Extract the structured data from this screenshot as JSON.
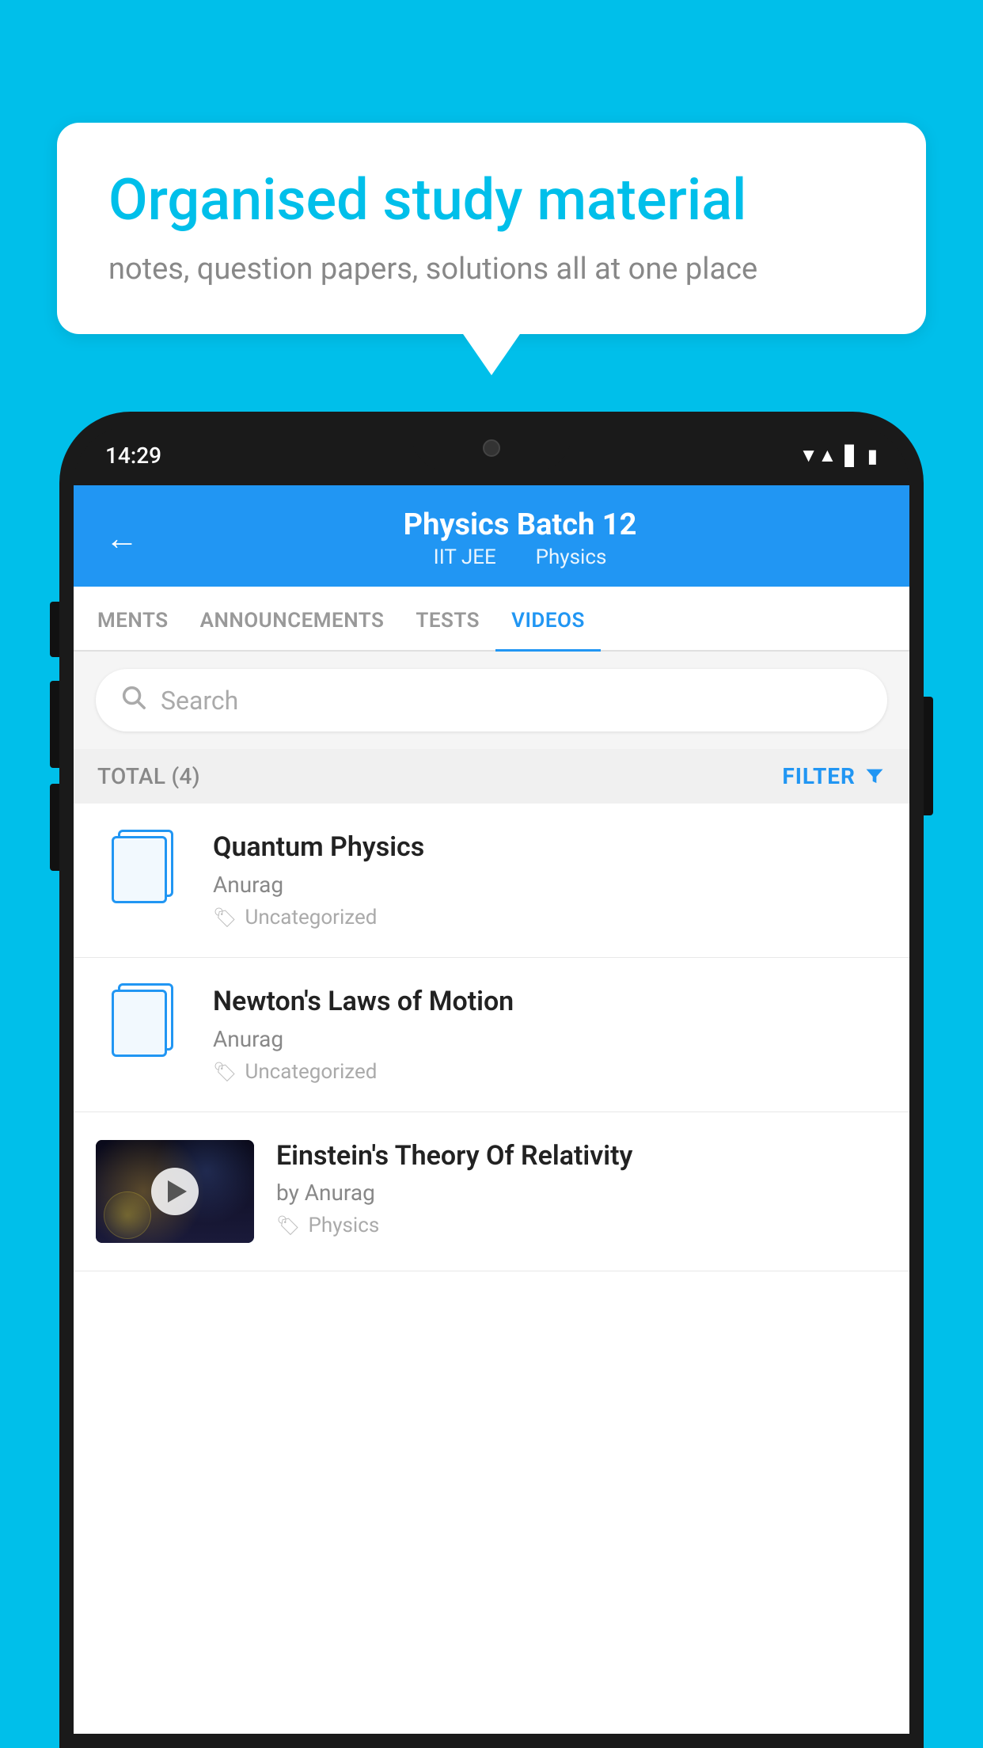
{
  "background_color": "#00BFEA",
  "speech_bubble": {
    "title": "Organised study material",
    "subtitle": "notes, question papers, solutions all at one place"
  },
  "phone": {
    "time": "14:29",
    "header": {
      "title": "Physics Batch 12",
      "tag1": "IIT JEE",
      "tag2": "Physics"
    },
    "tabs": [
      {
        "label": "MENTS",
        "active": false
      },
      {
        "label": "ANNOUNCEMENTS",
        "active": false
      },
      {
        "label": "TESTS",
        "active": false
      },
      {
        "label": "VIDEOS",
        "active": true
      }
    ],
    "search": {
      "placeholder": "Search"
    },
    "filter": {
      "total_label": "TOTAL (4)",
      "filter_label": "FILTER"
    },
    "videos": [
      {
        "title": "Quantum Physics",
        "author": "Anurag",
        "tag": "Uncategorized",
        "has_thumbnail": false
      },
      {
        "title": "Newton's Laws of Motion",
        "author": "Anurag",
        "tag": "Uncategorized",
        "has_thumbnail": false
      },
      {
        "title": "Einstein's Theory Of Relativity",
        "author": "by Anurag",
        "tag": "Physics",
        "has_thumbnail": true
      }
    ]
  }
}
